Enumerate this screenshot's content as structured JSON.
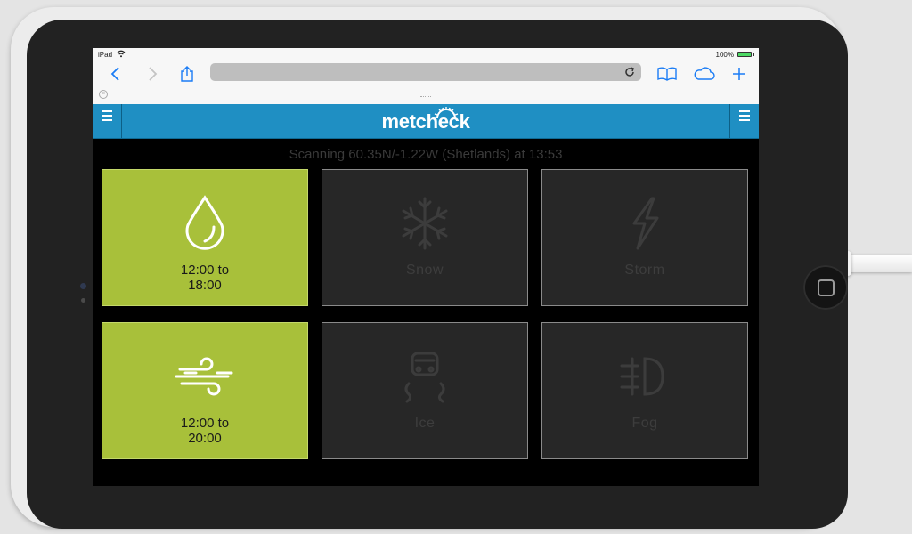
{
  "status_bar": {
    "device": "iPad",
    "battery": "100%"
  },
  "site": {
    "logo": "metcheck",
    "scan_status": "Scanning 60.35N/-1.22W (Shetlands) at 13:53"
  },
  "tiles": [
    {
      "name": "rain",
      "label": "12:00 to\n18:00",
      "active": true,
      "icon": "raindrop-icon"
    },
    {
      "name": "snow",
      "label": "Snow",
      "active": false,
      "icon": "snowflake-icon"
    },
    {
      "name": "storm",
      "label": "Storm",
      "active": false,
      "icon": "lightning-icon"
    },
    {
      "name": "wind",
      "label": "12:00 to\n20:00",
      "active": true,
      "icon": "wind-icon"
    },
    {
      "name": "ice",
      "label": "Ice",
      "active": false,
      "icon": "skidding-car-icon"
    },
    {
      "name": "fog",
      "label": "Fog",
      "active": false,
      "icon": "fog-light-icon"
    }
  ],
  "colors": {
    "header": "#1f8fc3",
    "active_tile": "#a8c03a",
    "inactive_tile": "#272727",
    "ios_blue": "#1a7cf5"
  }
}
